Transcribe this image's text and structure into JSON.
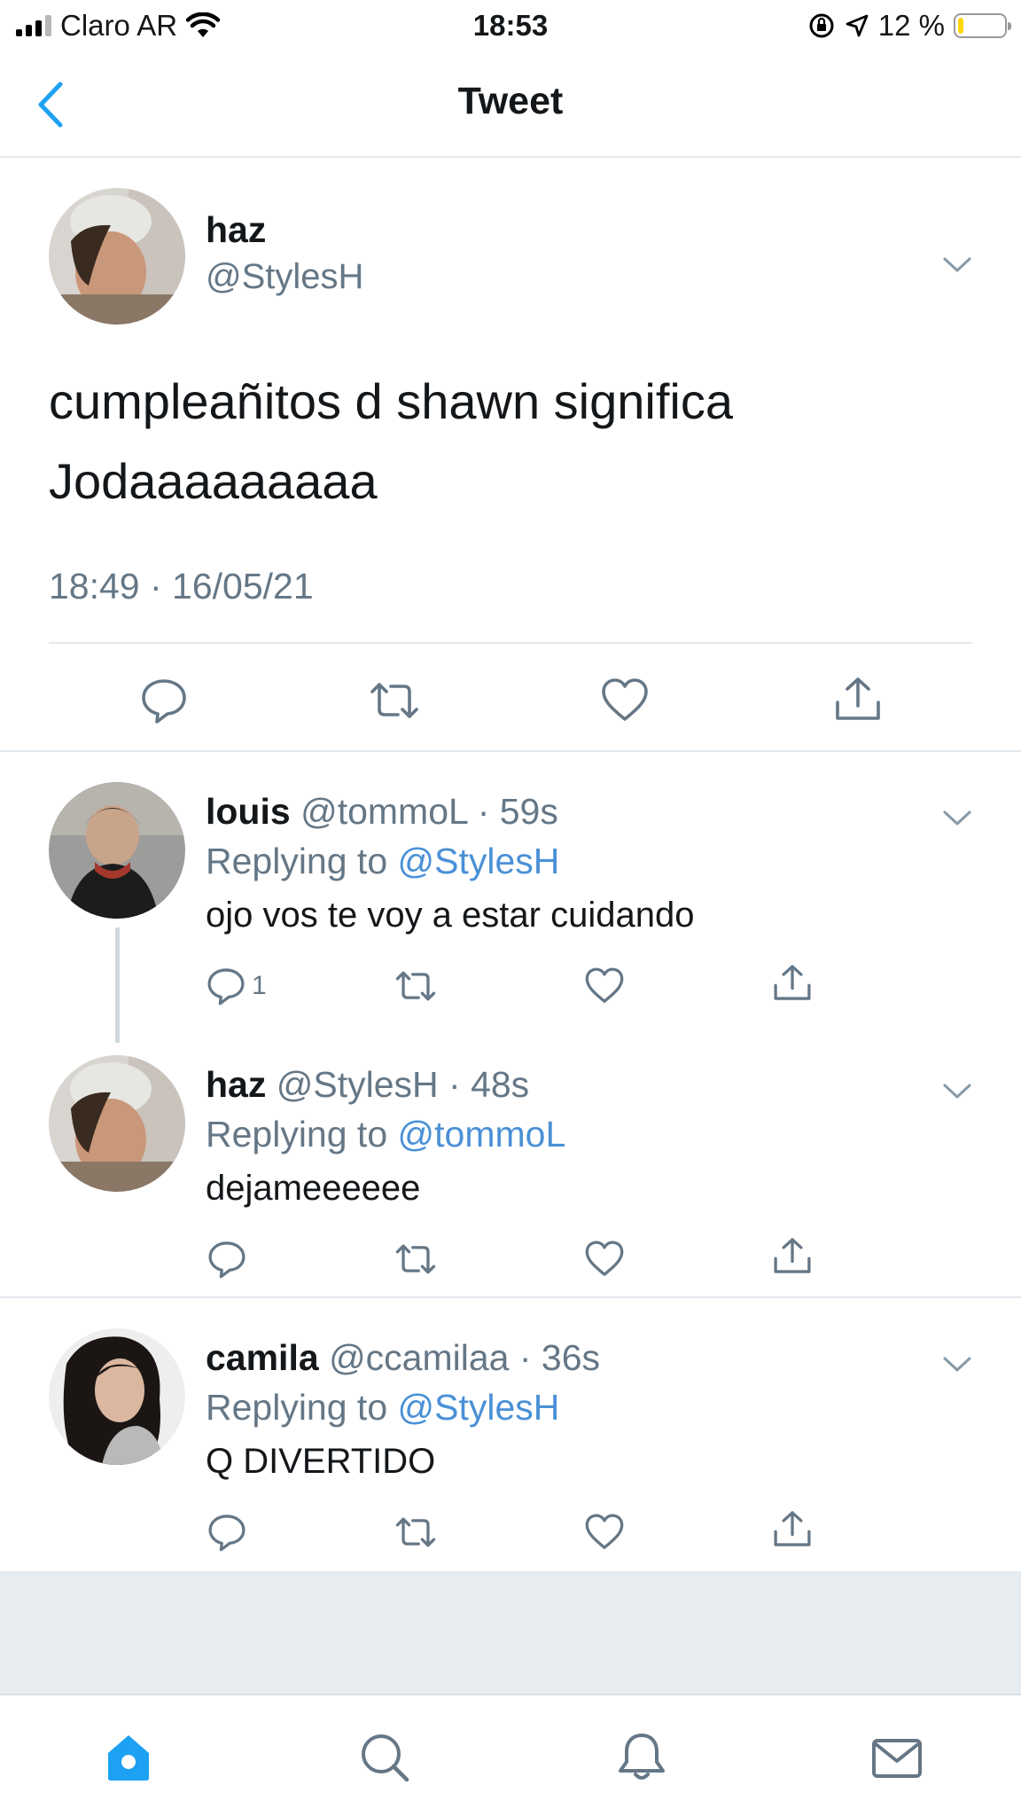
{
  "status_bar": {
    "carrier": "Claro AR",
    "time": "18:53",
    "battery_percent": "12 %",
    "battery_level": 0.12
  },
  "header": {
    "title": "Tweet"
  },
  "main_tweet": {
    "name": "haz",
    "handle": "@StylesH",
    "text_line1": "cumpleañitos d shawn significa",
    "text_line2": "Jodaaaaaaaaa",
    "timestamp": "18:49 · 16/05/21"
  },
  "replies": [
    {
      "name": "louis",
      "handle_time": "@tommoL · 59s",
      "replying_label": "Replying to",
      "replying_to": "@StylesH",
      "text": "ojo vos te voy a estar cuidando",
      "reply_count": "1"
    },
    {
      "name": "haz",
      "handle_time": "@StylesH · 48s",
      "replying_label": "Replying to",
      "replying_to": "@tommoL",
      "text": "dejameeeeee",
      "reply_count": ""
    },
    {
      "name": "camila",
      "handle_time": "@ccamilaa · 36s",
      "replying_label": "Replying to",
      "replying_to": "@StylesH",
      "text": "Q DIVERTIDO",
      "reply_count": ""
    }
  ],
  "icons": {
    "back": "chevron-left-icon",
    "more": "chevron-down-icon",
    "reply": "reply-bubble-icon",
    "retweet": "retweet-icon",
    "like": "heart-icon",
    "share": "share-icon",
    "tabs": [
      "home-icon",
      "search-icon",
      "bell-icon",
      "mail-icon"
    ]
  },
  "colors": {
    "accent": "#1da1f2",
    "mention": "#4a90d6",
    "secondary_text": "#657786",
    "divider": "#e1e8ed",
    "background_gray": "#e6ecf0"
  }
}
